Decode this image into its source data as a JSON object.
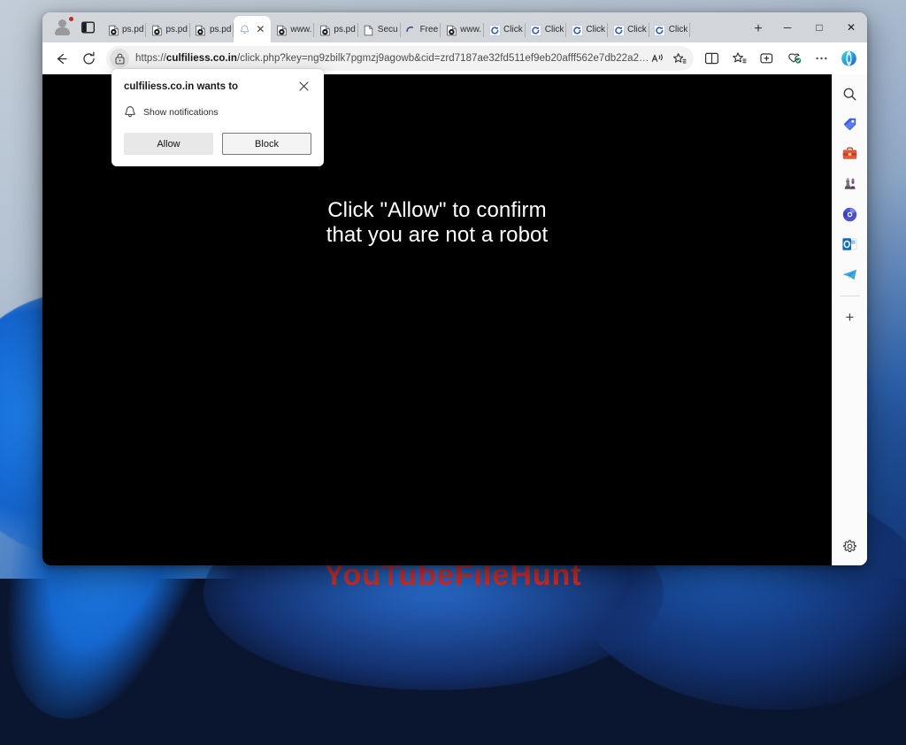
{
  "desktop": {
    "watermark_text": "YouTubeFileHunt"
  },
  "browser": {
    "profile": {
      "name": "profile-avatar",
      "has_notification_badge": true
    },
    "tab_actions_label": "Tab actions menu",
    "tabs": [
      {
        "label": "ps.pd",
        "favicon": "pdf-icon",
        "active": false
      },
      {
        "label": "ps.pd",
        "favicon": "pdf-icon",
        "active": false
      },
      {
        "label": "ps.pd",
        "favicon": "pdf-icon",
        "active": false
      },
      {
        "label": "",
        "favicon": "bell-icon",
        "active": true
      },
      {
        "label": "www.",
        "favicon": "pdf-icon",
        "active": false
      },
      {
        "label": "ps.pd",
        "favicon": "pdf-icon",
        "active": false
      },
      {
        "label": "Secu",
        "favicon": "page-icon",
        "active": false
      },
      {
        "label": "Free",
        "favicon": "loading-spinner",
        "active": false
      },
      {
        "label": "www.",
        "favicon": "pdf-icon",
        "active": false
      },
      {
        "label": "Click",
        "favicon": "refresh-blue-icon",
        "active": false
      },
      {
        "label": "Click",
        "favicon": "refresh-blue-icon",
        "active": false
      },
      {
        "label": "Click",
        "favicon": "refresh-blue-icon",
        "active": false
      },
      {
        "label": "Click",
        "favicon": "refresh-blue-icon",
        "active": false
      },
      {
        "label": "Click",
        "favicon": "refresh-blue-icon",
        "active": false
      }
    ],
    "new_tab_label": "+",
    "window_controls": {
      "minimize": "─",
      "maximize": "□",
      "close": "✕"
    },
    "navigation": {
      "back_label": "←",
      "refresh_label": "↻"
    },
    "address_bar": {
      "scheme": "https://",
      "host": "culfiliess.co.in",
      "path": "/click.php?key=ng9zbilk7pgmzj9agowb&cid=zrd7187ae32fd511ef9eb20afff562e7db22a2…",
      "full_url": "https://culfiliess.co.in/click.php?key=ng9zbilk7pgmzj9agowb&cid=zrd7187ae32fd511ef9eb20afff562e7db22a2…",
      "site_info_icon": "lock-icon"
    },
    "toolbar_right": [
      {
        "name": "read-aloud-icon",
        "glyph": "A"
      },
      {
        "name": "favorite-star-icon",
        "glyph": "☆"
      },
      {
        "name": "split-screen-icon",
        "glyph": "◫"
      },
      {
        "name": "collections-icon",
        "glyph": "☆"
      },
      {
        "name": "browser-essentials-icon",
        "glyph": "⊕"
      },
      {
        "name": "more-options-icon",
        "glyph": "⋯"
      },
      {
        "name": "copilot-icon",
        "glyph": "◐"
      }
    ]
  },
  "sidebar": {
    "items": [
      {
        "name": "search-icon",
        "glyph": "🔍",
        "label": "Search"
      },
      {
        "name": "shopping-tag-icon",
        "glyph": "🏷",
        "label": "Shopping"
      },
      {
        "name": "tools-briefcase-icon",
        "glyph": "🧰",
        "label": "Tools"
      },
      {
        "name": "games-icon",
        "glyph": "♟",
        "label": "Games"
      },
      {
        "name": "office-icon",
        "glyph": "⬤",
        "label": "Microsoft 365"
      },
      {
        "name": "outlook-icon",
        "glyph": "✉",
        "label": "Outlook"
      },
      {
        "name": "telegram-icon",
        "glyph": "➤",
        "label": "Telegram"
      }
    ],
    "add_label": "+",
    "settings_label": "⚙"
  },
  "page": {
    "message_line1": "Click \"Allow\" to confirm",
    "message_line2": "that you are not a robot",
    "background_color": "#000000",
    "text_color": "#ffffff"
  },
  "permission_popup": {
    "title": "culfiliess.co.in wants to",
    "close_label": "✕",
    "permission_icon": "bell-icon",
    "permission_label": "Show notifications",
    "allow_label": "Allow",
    "block_label": "Block"
  }
}
